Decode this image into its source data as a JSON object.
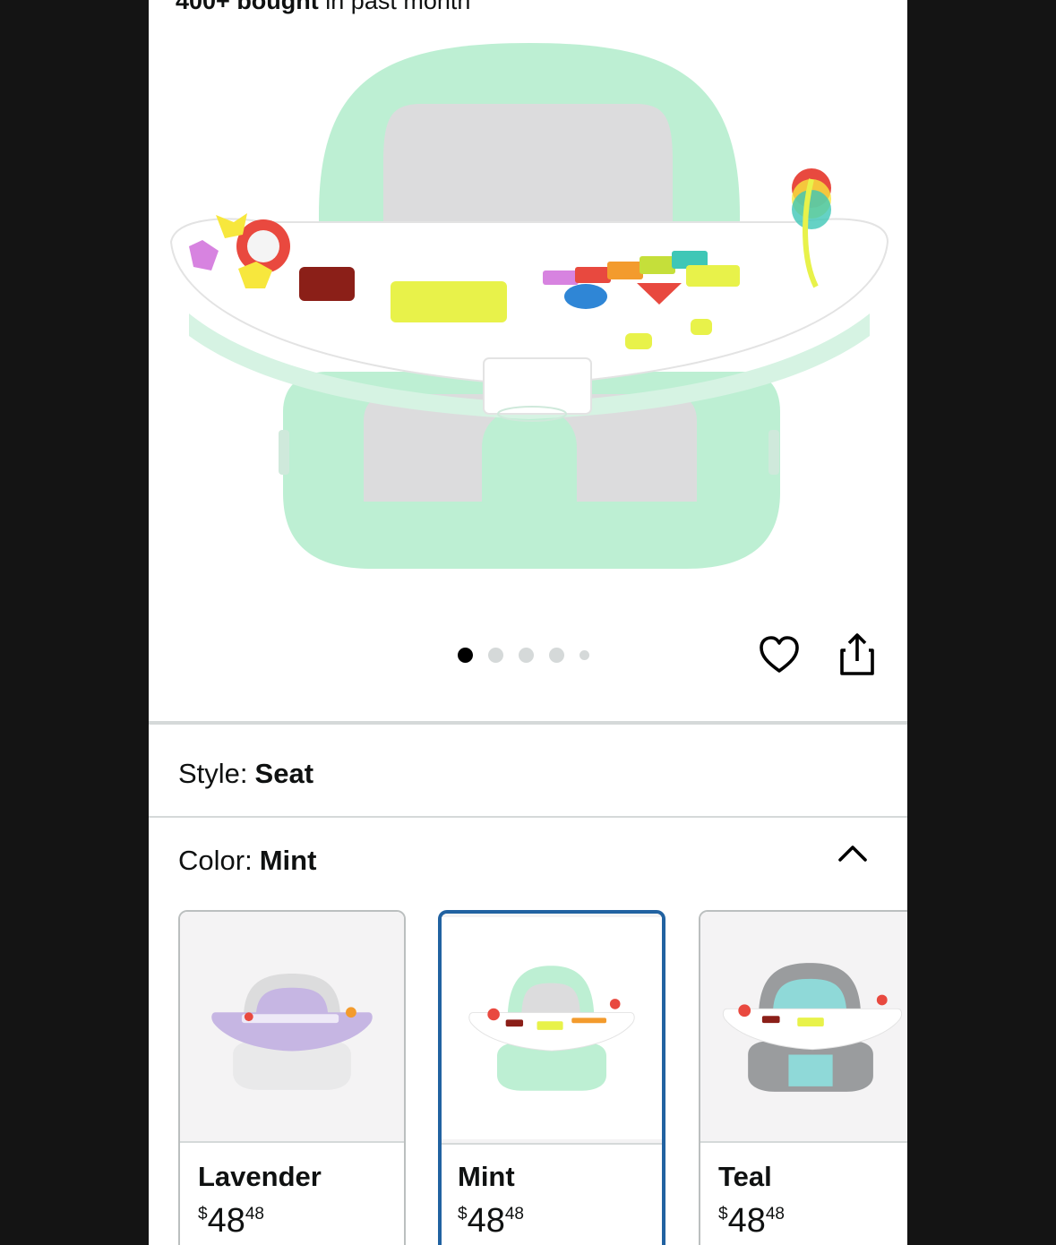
{
  "product": {
    "bought_count": "400+ bought",
    "bought_suffix": " in past month",
    "image_dots": 5,
    "active_dot": 0
  },
  "actions": {
    "wishlist_icon": "heart-icon",
    "share_icon": "share-icon"
  },
  "style": {
    "label": "Style:",
    "value": "Seat"
  },
  "color": {
    "label": "Color:",
    "value": "Mint",
    "toggle_icon": "chevron-up-icon"
  },
  "swatches": [
    {
      "name": "Lavender",
      "currency": "$",
      "price_whole": "48",
      "price_fraction": "48",
      "tint": "#c6b6e3",
      "selected": false
    },
    {
      "name": "Mint",
      "currency": "$",
      "price_whole": "48",
      "price_fraction": "48",
      "tint": "#bfeed2",
      "selected": true
    },
    {
      "name": "Teal",
      "currency": "$",
      "price_whole": "48",
      "price_fraction": "48",
      "tint": "#8fd9d8",
      "selected": false
    }
  ],
  "colors": {
    "selected_border": "#2162a1",
    "mint": "#bdefd3"
  }
}
